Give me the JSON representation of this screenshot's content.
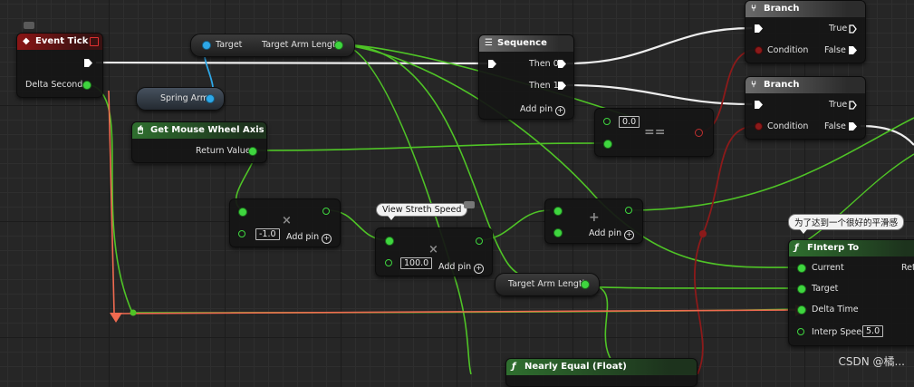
{
  "nodes": {
    "event_tick": {
      "title": "Event Tick",
      "pin_delta_seconds": "Delta Seconds"
    },
    "target_get": {
      "pin_target": "Target",
      "pin_target_arm_length": "Target Arm Length"
    },
    "spring_arm": {
      "label": "Spring Arm"
    },
    "mouse_wheel": {
      "title": "Get Mouse Wheel Axis",
      "pin_return": "Return Value"
    },
    "sequence": {
      "title": "Sequence",
      "then0": "Then 0",
      "then1": "Then 1",
      "add_pin": "Add pin"
    },
    "branch1": {
      "title": "Branch",
      "true_label": "True",
      "condition": "Condition",
      "false_label": "False"
    },
    "branch2": {
      "title": "Branch",
      "true_label": "True",
      "condition": "Condition",
      "false_label": "False"
    },
    "equal": {
      "value": "0.0",
      "symbol": "=="
    },
    "multiply1": {
      "value": "-1.0",
      "add_pin": "Add pin",
      "symbol": "×"
    },
    "multiply2": {
      "value": "100.0",
      "add_pin": "Add pin",
      "symbol": "×",
      "comment": "View Streth Speed"
    },
    "add": {
      "add_pin": "Add pin",
      "symbol": "+"
    },
    "target_arm_length": {
      "label": "Target Arm Length"
    },
    "finterp": {
      "title": "FInterp To",
      "comment": "为了达到一个很好的平滑感",
      "current": "Current",
      "target": "Target",
      "delta_time": "Delta Time",
      "interp_speed": "Interp Speed",
      "interp_speed_value": "5.0",
      "return_partial": "Ret"
    },
    "nearly_equal": {
      "title": "Nearly Equal (Float)"
    }
  },
  "watermark": "CSDN @橘...",
  "colors": {
    "exec_wire": "#f0f0f0",
    "float_wire": "#5ed02e",
    "object_wire": "#2ea8e8",
    "bool_wire": "#8c1a1a",
    "orange_wire": "#f06a50"
  }
}
